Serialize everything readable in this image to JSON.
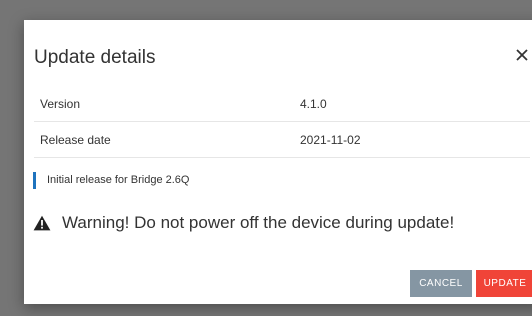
{
  "dialog": {
    "title": "Update details",
    "close_label": "Close"
  },
  "details": [
    {
      "label": "Version",
      "value": "4.1.0"
    },
    {
      "label": "Release date",
      "value": "2021-11-02"
    }
  ],
  "note": "Initial release for Bridge 2.6Q",
  "warning": {
    "icon": "warning-icon",
    "text": "Warning! Do not power off the device during update!"
  },
  "actions": {
    "cancel_label": "CANCEL",
    "update_label": "UPDATE"
  },
  "colors": {
    "accent_bar": "#1e73be",
    "cancel_button": "#8596a3",
    "update_button": "#f04438",
    "overlay": "#757575"
  }
}
